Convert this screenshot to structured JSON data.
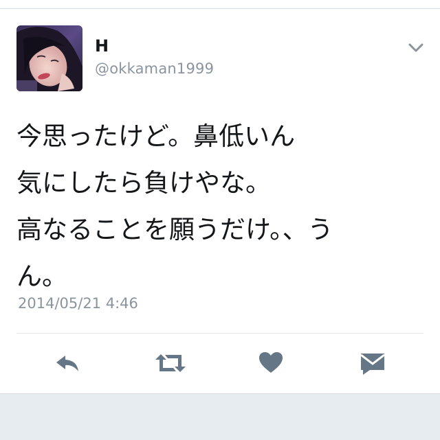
{
  "tweet": {
    "display_name": "H",
    "handle": "@okkaman1999",
    "text": "今思ったけど。鼻低いん\n気にしたら負けやな。\n高なることを願うだけ。、う\nん。",
    "timestamp": "2014/05/21 4:46"
  },
  "icons": {
    "menu": "chevron-down-icon",
    "reply": "reply-icon",
    "retweet": "retweet-icon",
    "like": "heart-icon",
    "dm": "envelope-icon"
  },
  "colors": {
    "icon_gray": "#657786",
    "text": "#14171a",
    "muted": "#8a949e",
    "footer": "#e6ecf0"
  }
}
